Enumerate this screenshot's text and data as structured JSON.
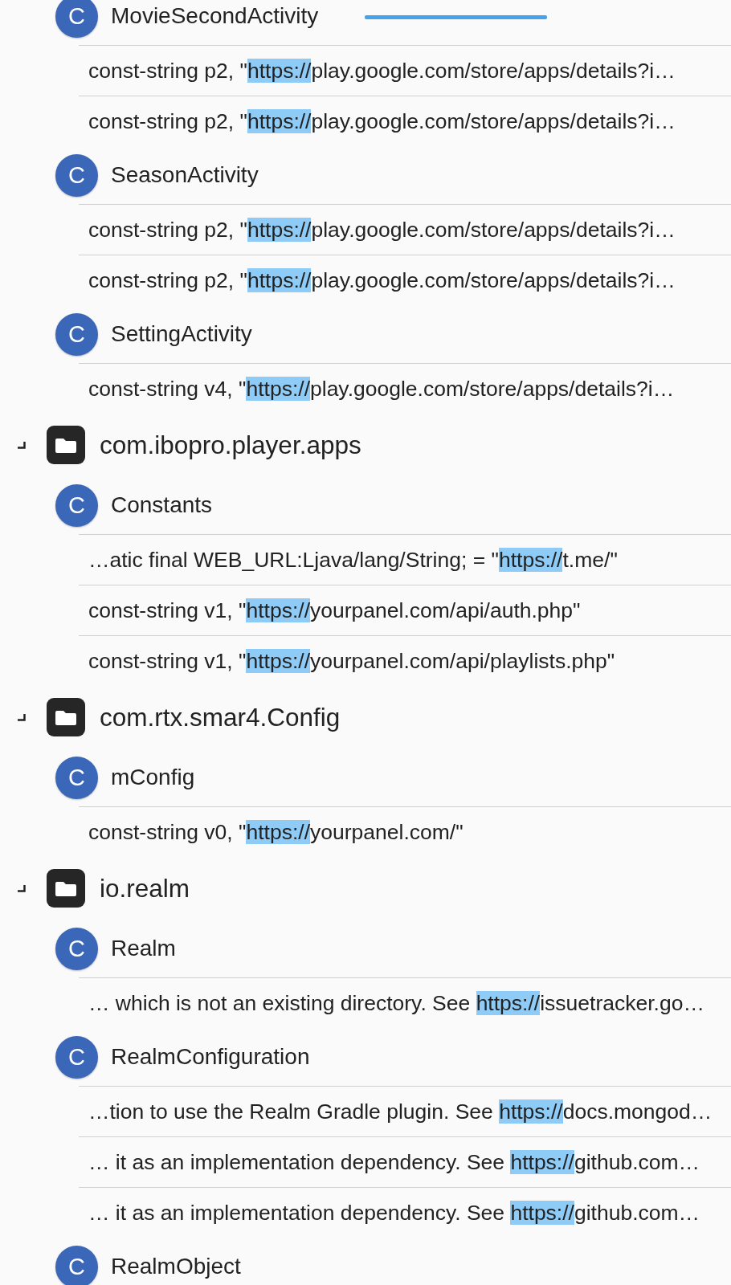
{
  "tree": [
    {
      "kind": "class",
      "badge": "C",
      "name": "MovieSecondActivity",
      "children": [
        {
          "kind": "match",
          "before": "const-string p2, \"",
          "match": "https://",
          "after": "play.google.com/store/apps/details?i…"
        },
        {
          "kind": "match",
          "before": "const-string p2, \"",
          "match": "https://",
          "after": "play.google.com/store/apps/details?i…"
        }
      ]
    },
    {
      "kind": "class",
      "badge": "C",
      "name": "SeasonActivity",
      "children": [
        {
          "kind": "match",
          "before": "const-string p2, \"",
          "match": "https://",
          "after": "play.google.com/store/apps/details?i…"
        },
        {
          "kind": "match",
          "before": "const-string p2, \"",
          "match": "https://",
          "after": "play.google.com/store/apps/details?i…"
        }
      ]
    },
    {
      "kind": "class",
      "badge": "C",
      "name": "SettingActivity",
      "children": [
        {
          "kind": "match",
          "before": "const-string v4, \"",
          "match": "https://",
          "after": "play.google.com/store/apps/details?i…"
        }
      ]
    },
    {
      "kind": "package",
      "name": "com.ibopro.player.apps",
      "children": [
        {
          "kind": "class",
          "badge": "C",
          "name": "Constants",
          "children": [
            {
              "kind": "match",
              "before": "…atic final WEB_URL:Ljava/lang/String; = \"",
              "match": "https://",
              "after": "t.me/\""
            },
            {
              "kind": "match",
              "before": "const-string v1, \"",
              "match": "https://",
              "after": "yourpanel.com/api/auth.php\""
            },
            {
              "kind": "match",
              "before": "const-string v1, \"",
              "match": "https://",
              "after": "yourpanel.com/api/playlists.php\""
            }
          ]
        }
      ]
    },
    {
      "kind": "package",
      "name": "com.rtx.smar4.Config",
      "children": [
        {
          "kind": "class",
          "badge": "C",
          "name": "mConfig",
          "children": [
            {
              "kind": "match",
              "before": "const-string v0, \"",
              "match": "https://",
              "after": "yourpanel.com/\""
            }
          ]
        }
      ]
    },
    {
      "kind": "package",
      "name": "io.realm",
      "children": [
        {
          "kind": "class",
          "badge": "C",
          "name": "Realm",
          "children": [
            {
              "kind": "match",
              "before": "… which is not an existing directory. See ",
              "match": "https://",
              "after": "issuetracker.go…"
            }
          ]
        },
        {
          "kind": "class",
          "badge": "C",
          "name": "RealmConfiguration",
          "children": [
            {
              "kind": "match",
              "before": "…tion to use the Realm Gradle plugin. See ",
              "match": "https://",
              "after": "docs.mongod…"
            },
            {
              "kind": "match",
              "before": "… it as an implementation dependency. See ",
              "match": "https://",
              "after": "github.com…"
            },
            {
              "kind": "match",
              "before": "… it as an implementation dependency. See ",
              "match": "https://",
              "after": "github.com…"
            }
          ]
        },
        {
          "kind": "class",
          "badge": "C",
          "name": "RealmObject"
        }
      ]
    }
  ]
}
